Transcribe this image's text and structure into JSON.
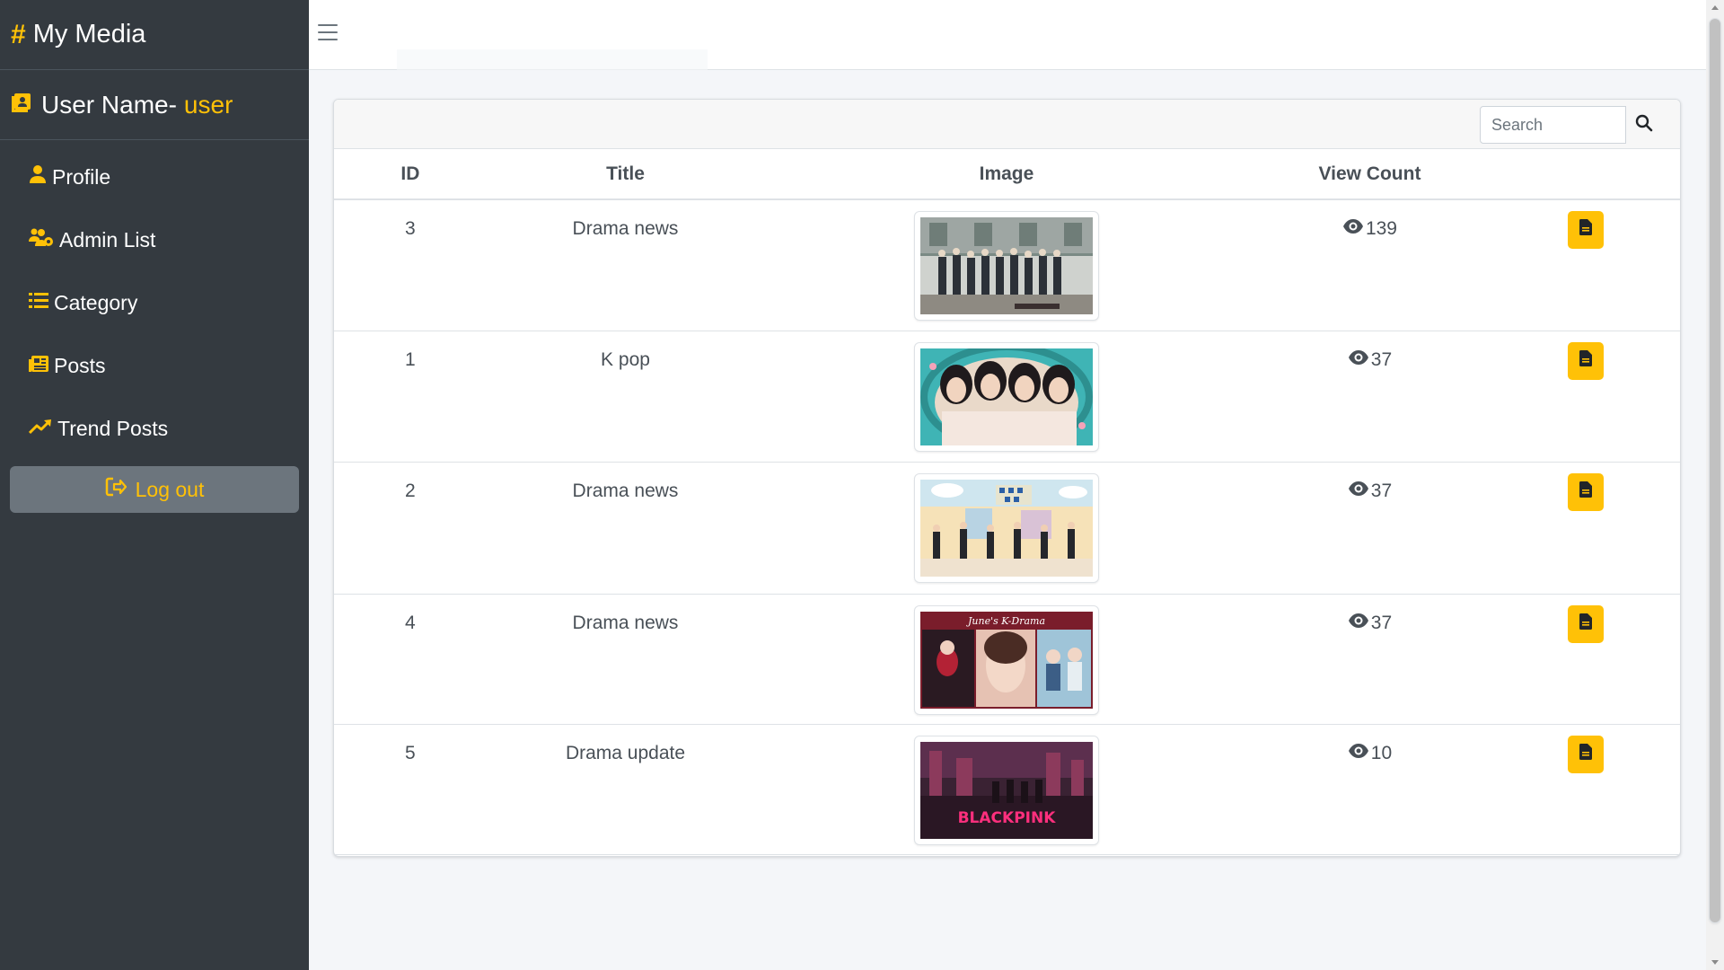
{
  "brand": {
    "title": "My Media"
  },
  "user": {
    "prefix": "User Name-",
    "name": "user"
  },
  "sidebar": {
    "items": [
      {
        "label": "Profile",
        "icon": "user-icon"
      },
      {
        "label": "Admin List",
        "icon": "users-gear-icon"
      },
      {
        "label": "Category",
        "icon": "list-icon"
      },
      {
        "label": "Posts",
        "icon": "newspaper-icon"
      },
      {
        "label": "Trend Posts",
        "icon": "trend-up-icon"
      }
    ],
    "logout_label": "Log out"
  },
  "search": {
    "placeholder": "Search"
  },
  "table": {
    "headers": {
      "id": "ID",
      "title": "Title",
      "image": "Image",
      "views": "View Count"
    },
    "rows": [
      {
        "id": "3",
        "title": "Drama news",
        "views": "139",
        "image": "group-photo-hallway"
      },
      {
        "id": "1",
        "title": "K pop",
        "views": "37",
        "image": "kpop-group-portrait"
      },
      {
        "id": "2",
        "title": "Drama news",
        "views": "37",
        "image": "drama-poster-street"
      },
      {
        "id": "4",
        "title": "Drama news",
        "views": "37",
        "image": "kdrama-collage",
        "image_caption": "June's K-Drama"
      },
      {
        "id": "5",
        "title": "Drama update",
        "views": "10",
        "image": "blackpink-concert",
        "image_caption": "BLACKPINK"
      }
    ]
  },
  "colors": {
    "accent": "#ffc107",
    "sidebar_bg": "#343a40",
    "logout_bg": "#6c757d"
  }
}
